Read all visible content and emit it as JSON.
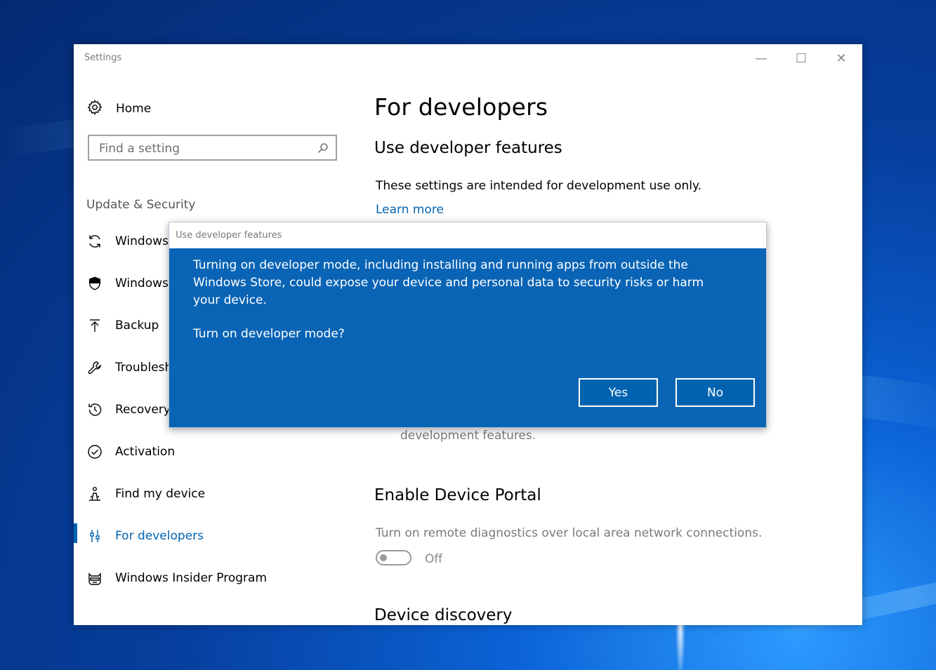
{
  "window": {
    "title": "Settings",
    "minimize_glyph": "—",
    "maximize_glyph": "☐",
    "close_glyph": "✕"
  },
  "sidebar": {
    "home_label": "Home",
    "search_placeholder": "Find a setting",
    "section_header": "Update & Security",
    "items": [
      {
        "label": "Windows",
        "icon": "refresh-icon"
      },
      {
        "label": "Windows",
        "icon": "shield-icon"
      },
      {
        "label": "Backup",
        "icon": "upload-arrow-icon"
      },
      {
        "label": "Troublesh",
        "icon": "wrench-icon"
      },
      {
        "label": "Recovery",
        "icon": "history-icon"
      },
      {
        "label": "Activation",
        "icon": "check-circle-icon"
      },
      {
        "label": "Find my device",
        "icon": "person-location-icon"
      },
      {
        "label": "For developers",
        "icon": "developer-tools-icon",
        "active": true
      },
      {
        "label": "Windows Insider Program",
        "icon": "ninja-cat-icon"
      }
    ]
  },
  "main": {
    "page_title": "For developers",
    "section1_heading": "Use developer features",
    "section1_desc": "These settings are intended for development use only.",
    "learn_more": "Learn more",
    "partial_text": "development features.",
    "section2_heading": "Enable Device Portal",
    "section2_desc": "Turn on remote diagnostics over local area network connections.",
    "toggle_label": "Off",
    "section3_heading": "Device discovery"
  },
  "dialog": {
    "title": "Use developer features",
    "message": "Turning on developer mode, including installing and running apps from outside the Windows Store, could expose your device and personal data to security risks or harm your device.",
    "question": "Turn on developer mode?",
    "yes_label": "Yes",
    "no_label": "No"
  },
  "colors": {
    "accent": "#0063b1",
    "dialog_bg": "#0a64b5"
  }
}
